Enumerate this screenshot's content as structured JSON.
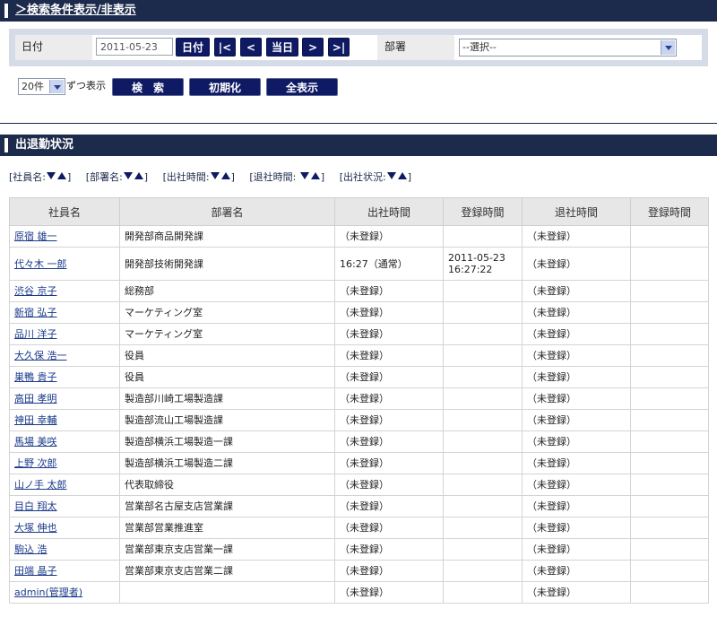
{
  "search": {
    "toggle_label": "＞検索条件表示/非表示",
    "date_label": "日付",
    "date_value": "2011-05-23",
    "nav": {
      "today_label": "日付",
      "first": "|<",
      "prev": "<",
      "current": "当日",
      "next": ">",
      "last": ">|"
    },
    "dept_label": "部署",
    "dept_selected": "--選択--",
    "page_size": "20件",
    "page_suffix": "ずつ表示",
    "btn_search": "検　索",
    "btn_reset": "初期化",
    "btn_show_all": "全表示"
  },
  "status": {
    "title": "出退勤状況",
    "sort_labels": [
      "[社員名:",
      "[部署名:",
      "[出社時間:",
      "[退社時間: ",
      "[出社状況:"
    ],
    "columns": [
      "社員名",
      "部署名",
      "出社時間",
      "登録時間",
      "退社時間",
      "登録時間"
    ],
    "rows": [
      {
        "name": "原宿 雄一",
        "dept": "開発部商品開発課",
        "in": "（未登録）",
        "in_reg": "",
        "out": "（未登録）",
        "out_reg": ""
      },
      {
        "name": "代々木 一郎",
        "dept": "開発部技術開発課",
        "in": "16:27（通常）",
        "in_reg": "2011-05-23 16:27:22",
        "out": "（未登録）",
        "out_reg": ""
      },
      {
        "name": "渋谷 京子",
        "dept": "総務部",
        "in": "（未登録）",
        "in_reg": "",
        "out": "（未登録）",
        "out_reg": ""
      },
      {
        "name": "新宿 弘子",
        "dept": "マーケティング室",
        "in": "（未登録）",
        "in_reg": "",
        "out": "（未登録）",
        "out_reg": ""
      },
      {
        "name": "品川 洋子",
        "dept": "マーケティング室",
        "in": "（未登録）",
        "in_reg": "",
        "out": "（未登録）",
        "out_reg": ""
      },
      {
        "name": "大久保 浩一",
        "dept": "役員",
        "in": "（未登録）",
        "in_reg": "",
        "out": "（未登録）",
        "out_reg": ""
      },
      {
        "name": "巣鴨 貴子",
        "dept": "役員",
        "in": "（未登録）",
        "in_reg": "",
        "out": "（未登録）",
        "out_reg": ""
      },
      {
        "name": "高田 孝明",
        "dept": "製造部川崎工場製造課",
        "in": "（未登録）",
        "in_reg": "",
        "out": "（未登録）",
        "out_reg": ""
      },
      {
        "name": "神田 幸輔",
        "dept": "製造部流山工場製造課",
        "in": "（未登録）",
        "in_reg": "",
        "out": "（未登録）",
        "out_reg": ""
      },
      {
        "name": "馬場 美咲",
        "dept": "製造部横浜工場製造一課",
        "in": "（未登録）",
        "in_reg": "",
        "out": "（未登録）",
        "out_reg": ""
      },
      {
        "name": "上野 次郎",
        "dept": "製造部横浜工場製造二課",
        "in": "（未登録）",
        "in_reg": "",
        "out": "（未登録）",
        "out_reg": ""
      },
      {
        "name": "山ノ手 太郎",
        "dept": "代表取締役",
        "in": "（未登録）",
        "in_reg": "",
        "out": "（未登録）",
        "out_reg": ""
      },
      {
        "name": "目白 翔太",
        "dept": "営業部名古屋支店営業課",
        "in": "（未登録）",
        "in_reg": "",
        "out": "（未登録）",
        "out_reg": ""
      },
      {
        "name": "大塚 伸也",
        "dept": "営業部営業推進室",
        "in": "（未登録）",
        "in_reg": "",
        "out": "（未登録）",
        "out_reg": ""
      },
      {
        "name": "駒込 浩",
        "dept": "営業部東京支店営業一課",
        "in": "（未登録）",
        "in_reg": "",
        "out": "（未登録）",
        "out_reg": ""
      },
      {
        "name": "田端 晶子",
        "dept": "営業部東京支店営業二課",
        "in": "（未登録）",
        "in_reg": "",
        "out": "（未登録）",
        "out_reg": ""
      },
      {
        "name": "admin(管理者)",
        "dept": "",
        "in": "（未登録）",
        "in_reg": "",
        "out": "（未登録）",
        "out_reg": ""
      }
    ]
  }
}
